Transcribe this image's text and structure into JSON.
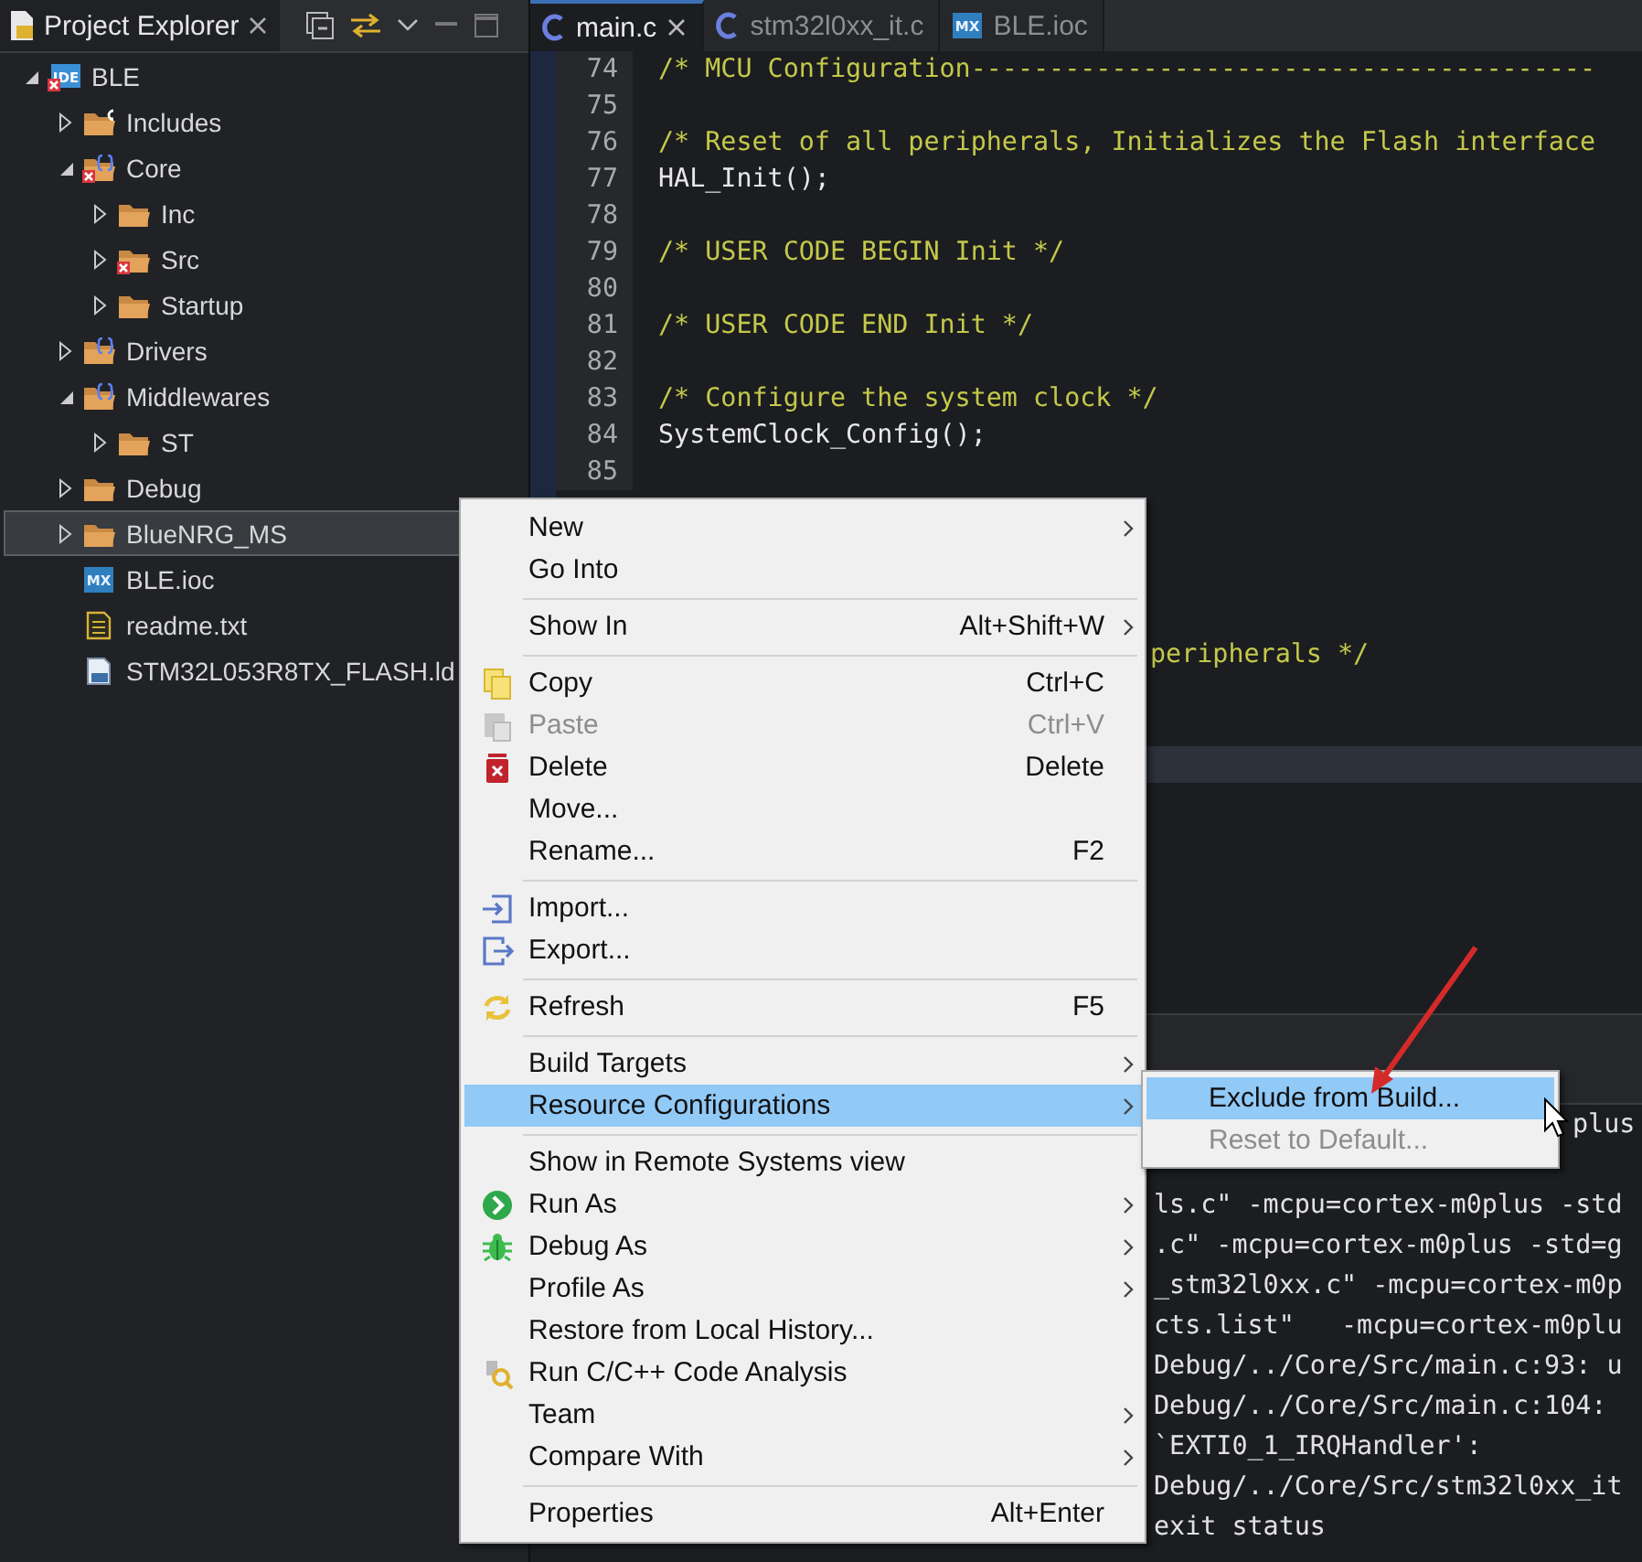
{
  "explorer": {
    "title": "Project Explorer",
    "tree": [
      {
        "label": "BLE",
        "kind": "project",
        "icon_text": "IDE",
        "error": true,
        "expanded": true,
        "selected": false,
        "children": [
          {
            "label": "Includes",
            "kind": "include-folder",
            "error": false,
            "expanded": false,
            "selected": false
          },
          {
            "label": "Core",
            "kind": "source-folder",
            "error": true,
            "expanded": true,
            "selected": false,
            "children": [
              {
                "label": "Inc",
                "kind": "folder",
                "error": false,
                "expanded": false,
                "selected": false
              },
              {
                "label": "Src",
                "kind": "folder",
                "error": true,
                "expanded": false,
                "selected": false
              },
              {
                "label": "Startup",
                "kind": "folder",
                "error": false,
                "expanded": false,
                "selected": false
              }
            ]
          },
          {
            "label": "Drivers",
            "kind": "source-folder",
            "error": false,
            "expanded": false,
            "selected": false
          },
          {
            "label": "Middlewares",
            "kind": "source-folder",
            "error": false,
            "expanded": true,
            "selected": false,
            "children": [
              {
                "label": "ST",
                "kind": "folder",
                "error": false,
                "expanded": false,
                "selected": false
              }
            ]
          },
          {
            "label": "Debug",
            "kind": "folder",
            "error": false,
            "expanded": false,
            "selected": false
          },
          {
            "label": "BlueNRG_MS",
            "kind": "folder",
            "error": false,
            "expanded": false,
            "selected": true
          },
          {
            "label": "BLE.ioc",
            "kind": "ioc",
            "icon_text": "MX",
            "error": false,
            "selected": false
          },
          {
            "label": "readme.txt",
            "kind": "text-file",
            "error": false,
            "selected": false
          },
          {
            "label": "STM32L053R8TX_FLASH.ld",
            "kind": "linker-file",
            "error": false,
            "selected": false
          }
        ]
      }
    ]
  },
  "editor": {
    "tabs": [
      {
        "label": "main.c",
        "kind": "c-file",
        "selected": true
      },
      {
        "label": "stm32l0xx_it.c",
        "kind": "c-file",
        "selected": false
      },
      {
        "label": "BLE.ioc",
        "kind": "ioc",
        "icon_text": "MX",
        "selected": false
      }
    ],
    "lines": [
      {
        "number": "74",
        "kind": "comment",
        "text": "/* MCU Configuration----------------------------------------"
      },
      {
        "number": "75",
        "kind": "blank"
      },
      {
        "number": "76",
        "kind": "comment",
        "text": "/* Reset of all peripherals, Initializes the Flash interface"
      },
      {
        "number": "77",
        "kind": "code",
        "text": "HAL_Init();"
      },
      {
        "number": "78",
        "kind": "blank"
      },
      {
        "number": "79",
        "kind": "comment",
        "text": "/* USER CODE BEGIN Init */"
      },
      {
        "number": "80",
        "kind": "blank"
      },
      {
        "number": "81",
        "kind": "comment",
        "text": "/* USER CODE END Init */"
      },
      {
        "number": "82",
        "kind": "blank"
      },
      {
        "number": "83",
        "kind": "comment",
        "text": "/* Configure the system clock */"
      },
      {
        "number": "84",
        "kind": "code",
        "text": "SystemClock_Config();"
      },
      {
        "number": "85",
        "kind": "blank"
      },
      {
        "kind": "fragment",
        "text": "peripherals */"
      }
    ]
  },
  "console": {
    "lines": [
      {
        "kind": "after-submenu",
        "text": "plus"
      },
      {
        "kind": "blank"
      },
      {
        "kind": "after-menu",
        "text": "ls.c\" -mcpu=cortex-m0plus -std"
      },
      {
        "kind": "after-menu",
        "text": ".c\" -mcpu=cortex-m0plus -std=g"
      },
      {
        "kind": "after-menu",
        "text": "_stm32l0xx.c\" -mcpu=cortex-m0p"
      },
      {
        "kind": "after-menu",
        "text": "cts.list\"   -mcpu=cortex-m0plu"
      },
      {
        "kind": "after-menu",
        "text": "Debug/../Core/Src/main.c:93: u"
      },
      {
        "kind": "after-menu",
        "text": "Debug/../Core/Src/main.c:104:"
      },
      {
        "kind": "after-menu",
        "text": "`EXTI0_1_IRQHandler':"
      },
      {
        "kind": "after-menu",
        "text": "Debug/../Core/Src/stm32l0xx_it"
      },
      {
        "kind": "after-menu",
        "text": "exit status"
      }
    ]
  },
  "context_menu": {
    "items": [
      {
        "kind": "item",
        "label": "New",
        "submenu": true,
        "disabled": false,
        "selected": false
      },
      {
        "kind": "item",
        "label": "Go Into",
        "submenu": false,
        "disabled": false,
        "selected": false
      },
      {
        "kind": "separator"
      },
      {
        "kind": "item",
        "label": "Show In",
        "shortcut": "Alt+Shift+W",
        "submenu": true,
        "disabled": false,
        "selected": false
      },
      {
        "kind": "separator"
      },
      {
        "kind": "item",
        "label": "Copy",
        "shortcut": "Ctrl+C",
        "submenu": false,
        "disabled": false,
        "selected": false
      },
      {
        "kind": "item",
        "label": "Paste",
        "shortcut": "Ctrl+V",
        "submenu": false,
        "disabled": true,
        "selected": false
      },
      {
        "kind": "item",
        "label": "Delete",
        "shortcut": "Delete",
        "submenu": false,
        "disabled": false,
        "selected": false
      },
      {
        "kind": "item",
        "label": "Move...",
        "submenu": false,
        "disabled": false,
        "selected": false
      },
      {
        "kind": "item",
        "label": "Rename...",
        "shortcut": "F2",
        "submenu": false,
        "disabled": false,
        "selected": false
      },
      {
        "kind": "separator"
      },
      {
        "kind": "item",
        "label": "Import...",
        "submenu": false,
        "disabled": false,
        "selected": false
      },
      {
        "kind": "item",
        "label": "Export...",
        "submenu": false,
        "disabled": false,
        "selected": false
      },
      {
        "kind": "separator"
      },
      {
        "kind": "item",
        "label": "Refresh",
        "shortcut": "F5",
        "submenu": false,
        "disabled": false,
        "selected": false
      },
      {
        "kind": "separator"
      },
      {
        "kind": "item",
        "label": "Build Targets",
        "submenu": true,
        "disabled": false,
        "selected": false
      },
      {
        "kind": "item",
        "label": "Resource Configurations",
        "submenu": true,
        "disabled": false,
        "selected": true
      },
      {
        "kind": "separator"
      },
      {
        "kind": "item",
        "label": "Show in Remote Systems view",
        "submenu": false,
        "disabled": false,
        "selected": false
      },
      {
        "kind": "item",
        "label": "Run As",
        "submenu": true,
        "disabled": false,
        "selected": false
      },
      {
        "kind": "item",
        "label": "Debug As",
        "submenu": true,
        "disabled": false,
        "selected": false
      },
      {
        "kind": "item",
        "label": "Profile As",
        "submenu": true,
        "disabled": false,
        "selected": false
      },
      {
        "kind": "item",
        "label": "Restore from Local History...",
        "submenu": false,
        "disabled": false,
        "selected": false
      },
      {
        "kind": "item",
        "label": "Run C/C++ Code Analysis",
        "submenu": false,
        "disabled": false,
        "selected": false
      },
      {
        "kind": "item",
        "label": "Team",
        "submenu": true,
        "disabled": false,
        "selected": false
      },
      {
        "kind": "item",
        "label": "Compare With",
        "submenu": true,
        "disabled": false,
        "selected": false
      },
      {
        "kind": "separator"
      },
      {
        "kind": "item",
        "label": "Properties",
        "shortcut": "Alt+Enter",
        "submenu": false,
        "disabled": false,
        "selected": false
      }
    ]
  },
  "submenu": {
    "items": [
      {
        "label": "Exclude from Build...",
        "disabled": false,
        "selected": true
      },
      {
        "label": "Reset to Default...",
        "disabled": true,
        "selected": false
      }
    ]
  }
}
